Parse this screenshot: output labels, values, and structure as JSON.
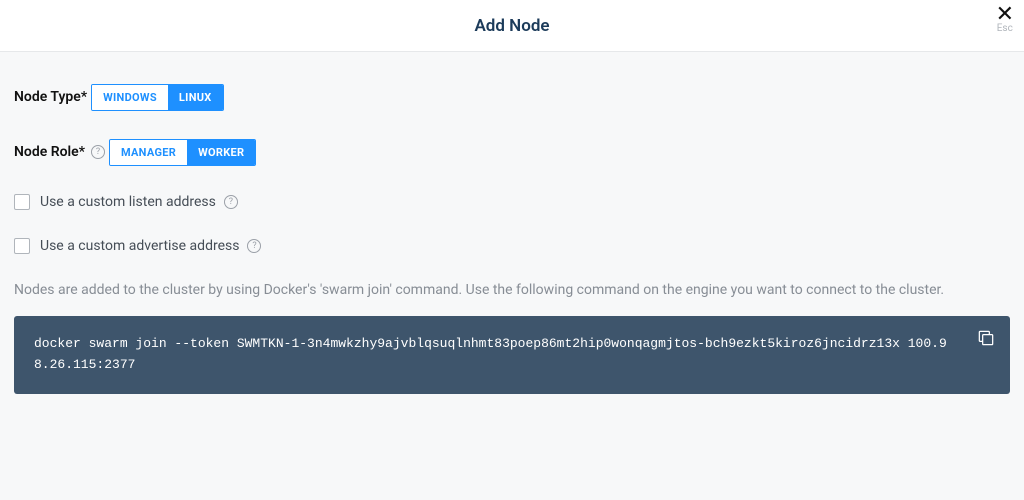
{
  "header": {
    "title": "Add Node",
    "close_hint": "Esc"
  },
  "nodeType": {
    "label": "Node Type*",
    "options": {
      "windows": "WINDOWS",
      "linux": "LINUX"
    }
  },
  "nodeRole": {
    "label": "Node Role*",
    "options": {
      "manager": "MANAGER",
      "worker": "WORKER"
    }
  },
  "checkboxes": {
    "listen": "Use a custom listen address",
    "advertise": "Use a custom advertise address"
  },
  "description": "Nodes are added to the cluster by using Docker's 'swarm join' command. Use the following command on the engine you want to connect to the cluster.",
  "command": "docker swarm join --token SWMTKN-1-3n4mwkzhy9ajvblqsuqlnhmt83poep86mt2hip0wonqagmjtos-bch9ezkt5kiroz6jncidrz13x 100.98.26.115:2377"
}
